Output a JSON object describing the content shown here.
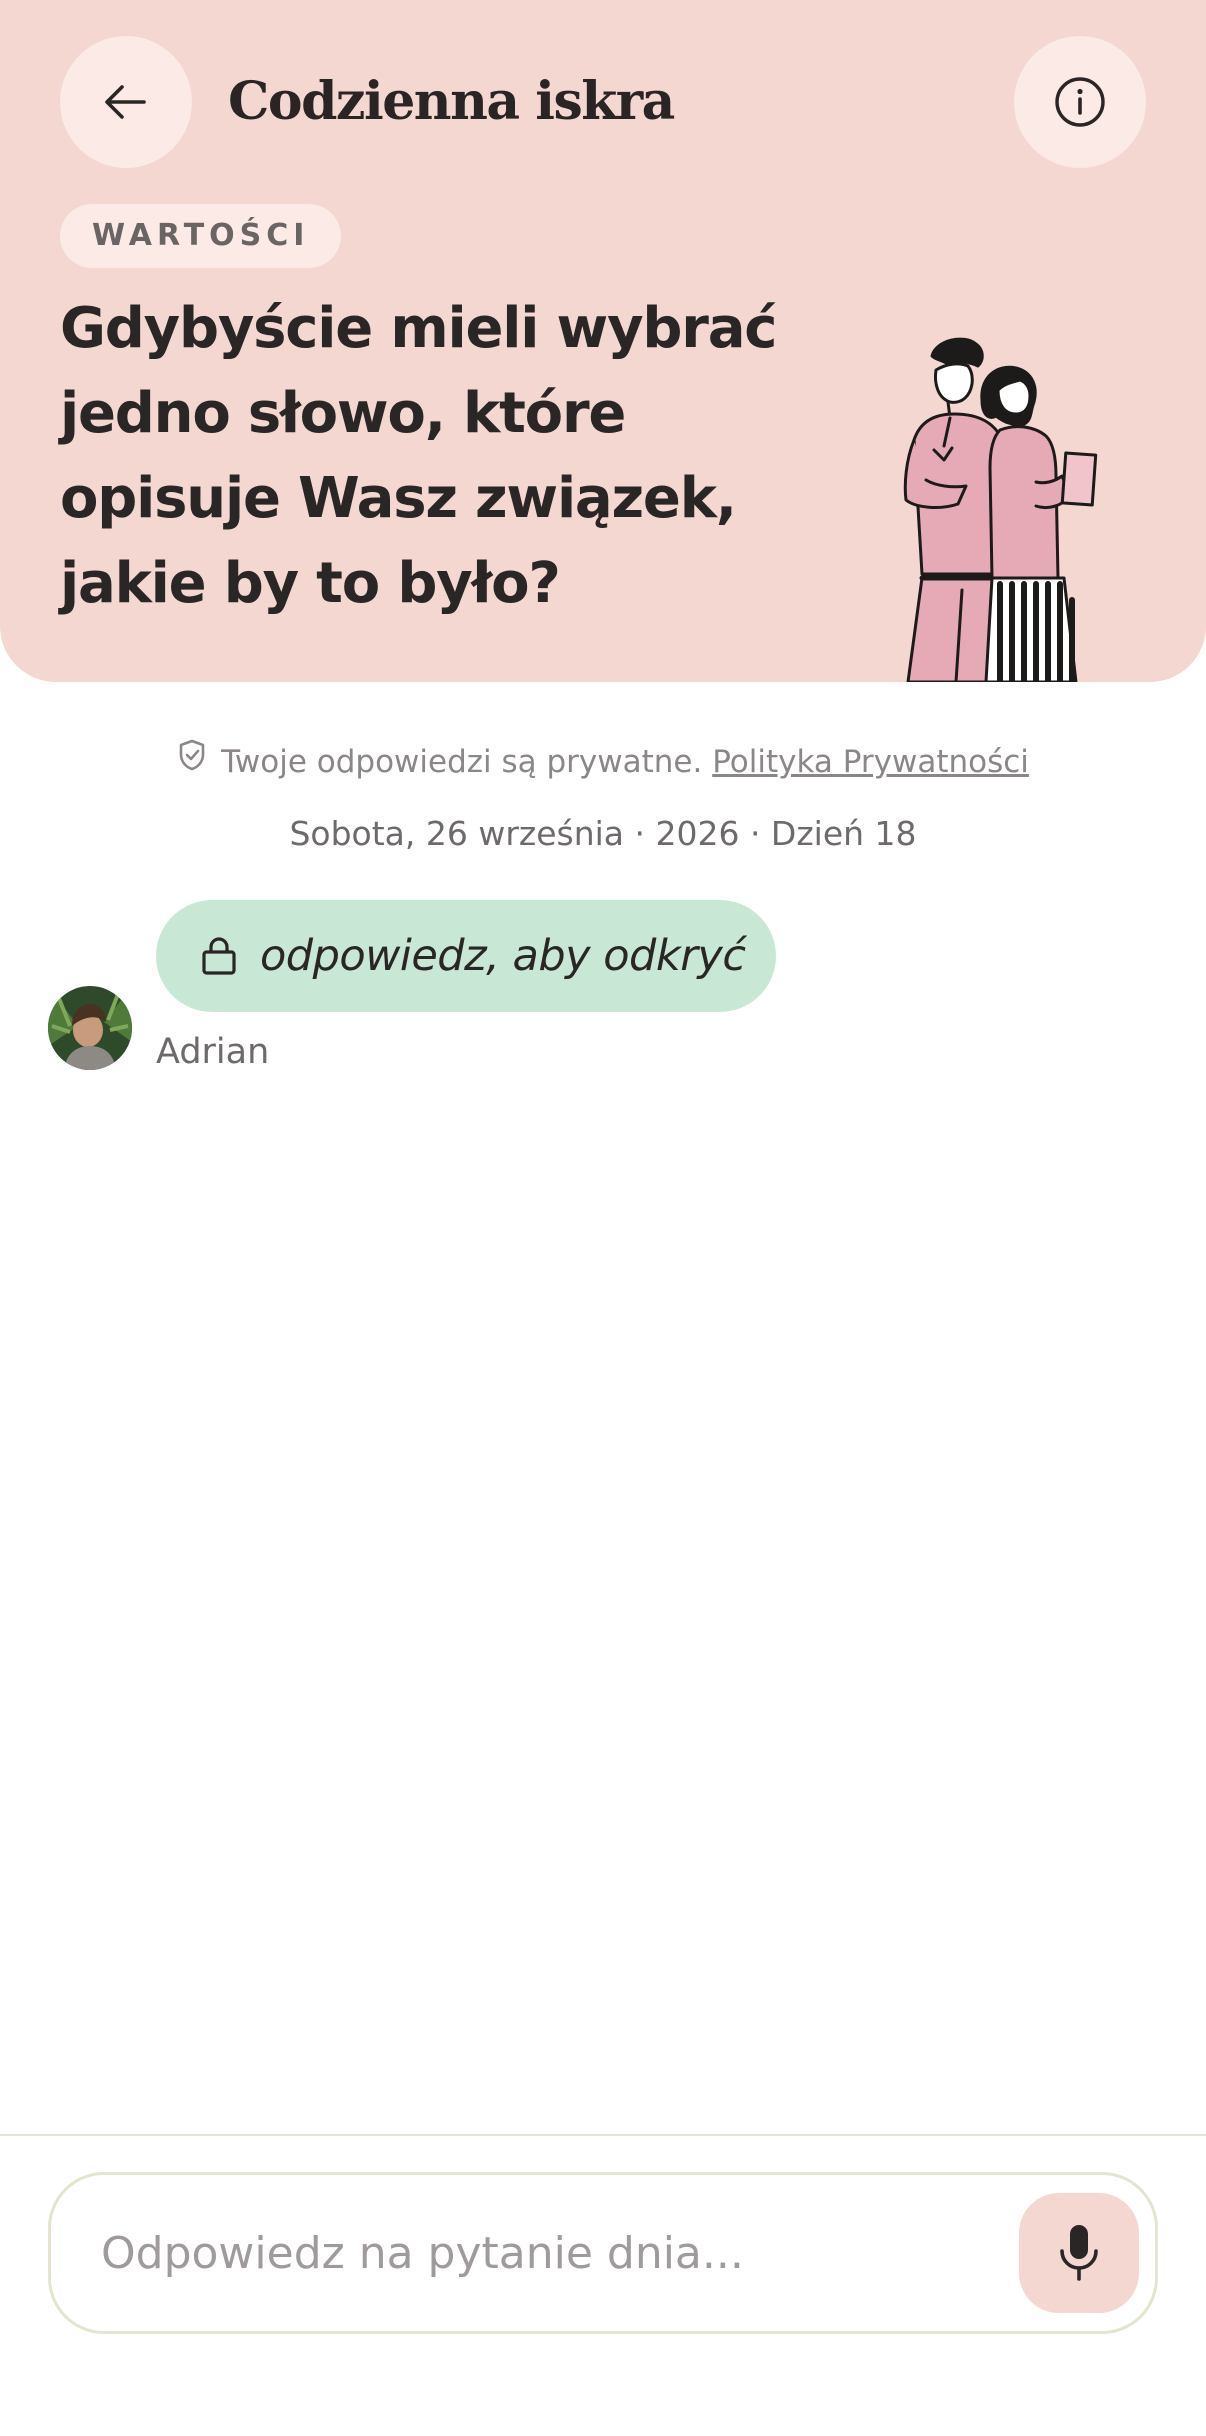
{
  "header": {
    "title": "Codzienna iskra",
    "back_icon": "arrow-left-icon",
    "info_icon": "info-circle-icon",
    "background_color": "#f4d7d1"
  },
  "prompt": {
    "category": "WARTOŚCI",
    "question": "Gdybyście mieli wybrać jedno słowo, które opisuje Wasz związek, jakie by to było?"
  },
  "privacy": {
    "text": "Twoje odpowiedzi są prywatne.",
    "link": "Polityka Prywatności",
    "icon": "shield-check-icon"
  },
  "date_line": "Sobota, 26 września · 2026 · Dzień 18",
  "message": {
    "locked_text": "odpowiedz, aby odkryć",
    "author": "Adrian",
    "bubble_color": "#c8e8d5",
    "lock_icon": "lock-icon"
  },
  "composer": {
    "placeholder": "Odpowiedz na pytanie dnia...",
    "mic_icon": "microphone-icon"
  }
}
